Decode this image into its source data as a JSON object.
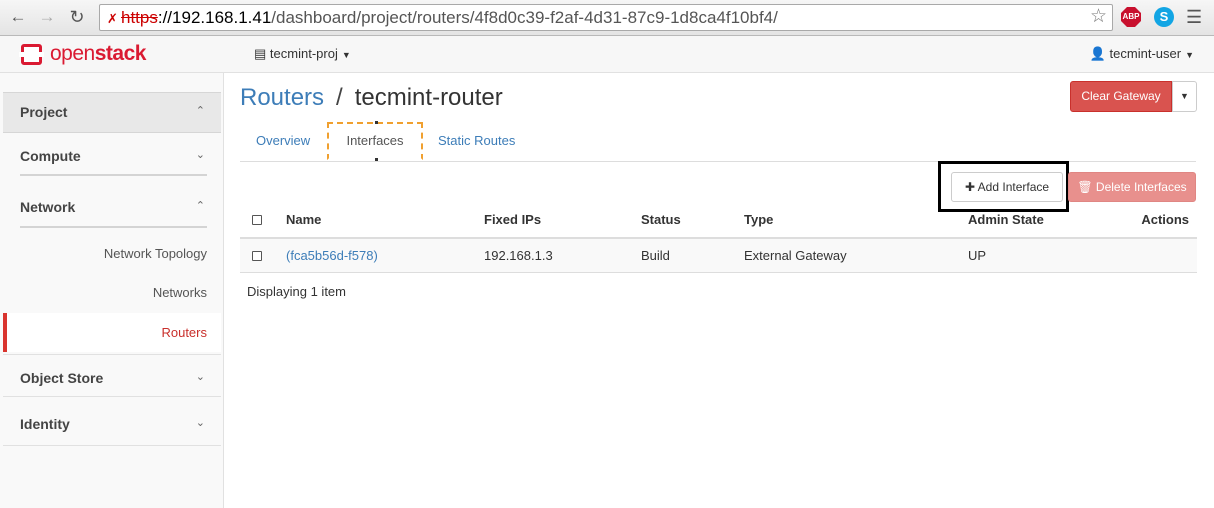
{
  "browser": {
    "url_scheme": "https",
    "url_host": "://192.168.1.41",
    "url_path": "/dashboard/project/routers/4f8d0c39-f2af-4d31-87c9-1d8ca4f10bf4/",
    "abp_label": "ABP",
    "skype_label": "S"
  },
  "header": {
    "brand_prefix": "open",
    "brand_suffix": "stack",
    "project": "tecmint-proj",
    "user": "tecmint-user"
  },
  "sidebar": {
    "project": "Project",
    "compute": "Compute",
    "network": "Network",
    "network_items": [
      "Network Topology",
      "Networks",
      "Routers"
    ],
    "object_store": "Object Store",
    "identity": "Identity"
  },
  "page": {
    "breadcrumb_parent": "Routers",
    "breadcrumb_separator": "/",
    "title": "tecmint-router",
    "clear_gateway": "Clear Gateway"
  },
  "tabs": [
    "Overview",
    "Interfaces",
    "Static Routes"
  ],
  "actions": {
    "add_interface": "Add Interface",
    "delete_interfaces": "Delete Interfaces"
  },
  "table": {
    "columns": [
      "Name",
      "Fixed IPs",
      "Status",
      "Type",
      "Admin State",
      "Actions"
    ],
    "rows": [
      {
        "name": "(fca5b56d-f578)",
        "fixed_ips": "192.168.1.3",
        "status": "Build",
        "type": "External Gateway",
        "admin_state": "UP"
      }
    ],
    "footer": "Displaying 1 item"
  },
  "colors": {
    "accent_red": "#da1a32",
    "link_blue": "#3d7db8",
    "danger": "#d9534f"
  }
}
